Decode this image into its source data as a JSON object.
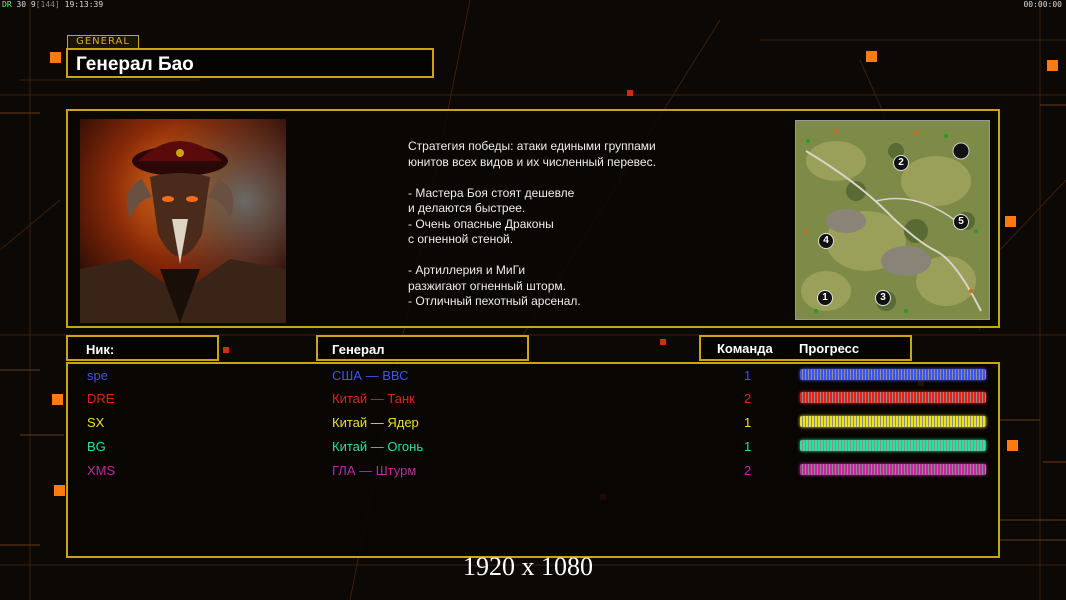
{
  "hud": {
    "left_a": "DR",
    "left_b": "30 9",
    "left_c": "[144]",
    "time": "19:13:39",
    "timer": "00:00:00"
  },
  "general": {
    "tag": "GENERAL",
    "title": "Генерал Бао",
    "description": "Стратегия победы: атаки едиными группами\nюнитов всех видов и их численный перевес.\n\n- Мастера Боя стоят дешевле\nи делаются быстрее.\n- Очень опасные Драконы\nс огненной стеной.\n\n- Артиллерия и МиГи\nразжигают огненный шторм.\n- Отличный пехотный арсенал."
  },
  "minimap": {
    "markers": [
      "1",
      "2",
      "3",
      "4",
      "5"
    ]
  },
  "headers": {
    "nick": "Ник:",
    "general": "Генерал",
    "team": "Команда",
    "progress": "Прогресс"
  },
  "players": [
    {
      "nick": "spe",
      "general": "США — ВВС",
      "team": "1",
      "color": "#3d55f0"
    },
    {
      "nick": "DRE",
      "general": "Китай — Танк",
      "team": "2",
      "color": "#e0241c"
    },
    {
      "nick": "SX",
      "general": "Китай — Ядер",
      "team": "1",
      "color": "#e8e22a"
    },
    {
      "nick": "BG",
      "general": "Китай — Огонь",
      "team": "1",
      "color": "#2ee0a0"
    },
    {
      "nick": "XMS",
      "general": "ГЛА — Штурм",
      "team": "2",
      "color": "#c02a9c"
    }
  ],
  "resolution": "1920 x 1080"
}
